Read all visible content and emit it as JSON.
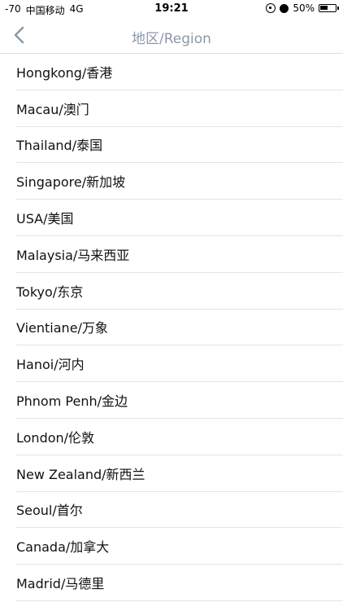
{
  "status_bar": {
    "signal": "-70",
    "carrier": "中国移动",
    "network": "4G",
    "time": "19:21",
    "battery": "50%"
  },
  "nav": {
    "title": "地区/Region"
  },
  "regions": [
    "Hongkong/香港",
    "Macau/澳门",
    "Thailand/泰国",
    "Singapore/新加坡",
    "USA/美国",
    "Malaysia/马来西亚",
    "Tokyo/东京",
    "Vientiane/万象",
    "Hanoi/河内",
    "Phnom Penh/金边",
    "London/伦敦",
    "New Zealand/新西兰",
    "Seoul/首尔",
    "Canada/加拿大",
    "Madrid/马德里"
  ]
}
